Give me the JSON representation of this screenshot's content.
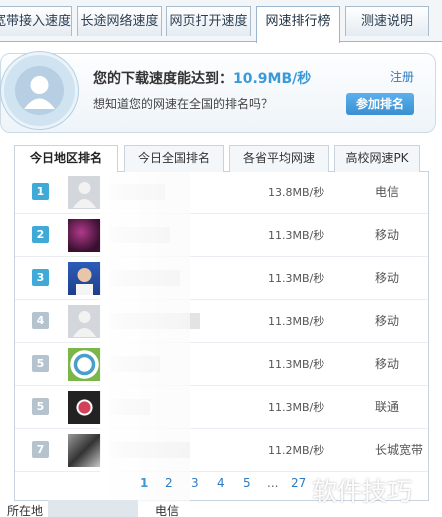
{
  "top_tabs": [
    "宽带接入速度",
    "长途网络速度",
    "网页打开速度",
    "网速排行榜",
    "测速说明"
  ],
  "header": {
    "speed_prefix": "您的下载速度能达到：",
    "speed_value": "10.9MB/秒",
    "question": "想知道您的网速在全国的排名吗？",
    "register": "注册",
    "join": "参加排名"
  },
  "rank_tabs": [
    "今日地区排名",
    "今日全国排名",
    "各省平均网速",
    "高校网速PK"
  ],
  "rows": [
    {
      "rank": "1",
      "speed": "13.8MB/秒",
      "isp": "电信",
      "badge": "#3fa9d8"
    },
    {
      "rank": "2",
      "speed": "11.3MB/秒",
      "isp": "移动",
      "badge": "#3fa9d8"
    },
    {
      "rank": "3",
      "speed": "11.3MB/秒",
      "isp": "移动",
      "badge": "#3fa9d8"
    },
    {
      "rank": "4",
      "speed": "11.3MB/秒",
      "isp": "移动",
      "badge": "#b5c3cf"
    },
    {
      "rank": "5",
      "speed": "11.3MB/秒",
      "isp": "移动",
      "badge": "#b5c3cf"
    },
    {
      "rank": "5",
      "speed": "11.3MB/秒",
      "isp": "联通",
      "badge": "#b5c3cf"
    },
    {
      "rank": "7",
      "speed": "11.2MB/秒",
      "isp": "长城宽带",
      "badge": "#b5c3cf"
    }
  ],
  "pagination": [
    "1",
    "2",
    "3",
    "4",
    "5",
    "...",
    "27"
  ],
  "footer": {
    "location_label": "所在地",
    "isp_label": "电信"
  },
  "watermark": "软件技巧"
}
